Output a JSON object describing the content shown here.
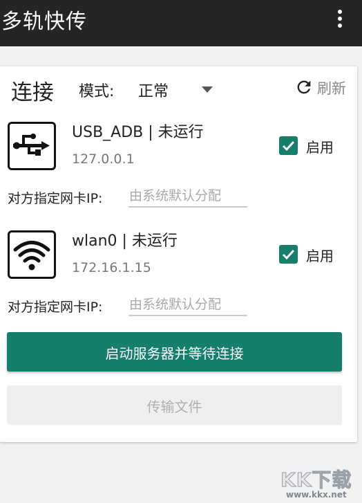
{
  "app_bar": {
    "title": "多轨快传",
    "more_icon": "more-vertical-icon"
  },
  "connection": {
    "section_title": "连接",
    "mode_label": "模式:",
    "mode_value": "正常",
    "refresh_label": "刷新"
  },
  "interfaces": [
    {
      "icon": "usb-icon",
      "name": "USB_ADB | 未运行",
      "ip": "127.0.0.1",
      "enabled": true,
      "enable_label": "启用",
      "peer_ip_label": "对方指定网卡IP:",
      "peer_ip_placeholder": "由系统默认分配",
      "peer_ip_value": ""
    },
    {
      "icon": "wifi-icon",
      "name": "wlan0 | 未运行",
      "ip": "172.16.1.15",
      "enabled": true,
      "enable_label": "启用",
      "peer_ip_label": "对方指定网卡IP:",
      "peer_ip_placeholder": "由系统默认分配",
      "peer_ip_value": ""
    }
  ],
  "actions": {
    "start_server_label": "启动服务器并等待连接",
    "transfer_files_label": "传输文件",
    "transfer_files_enabled": false
  },
  "watermark": {
    "logo_text": "KK下载",
    "url": "www.kkx.net"
  },
  "colors": {
    "app_bar": "#252525",
    "accent": "#157f6c",
    "background": "#f2f2f2"
  }
}
